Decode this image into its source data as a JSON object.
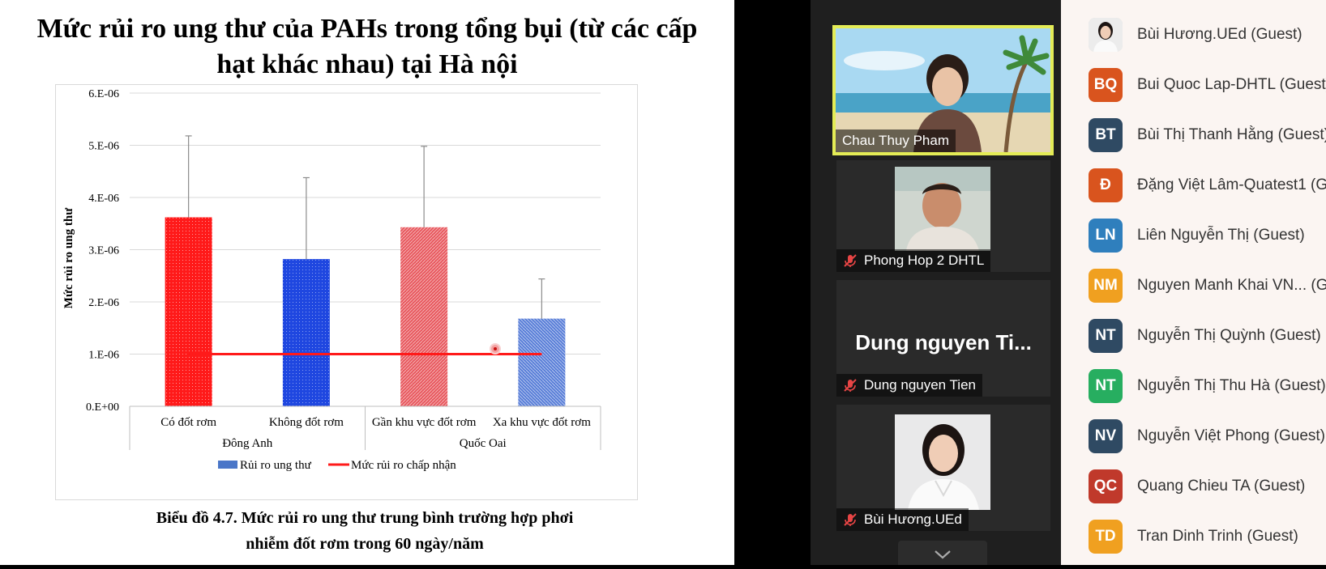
{
  "slide": {
    "title_line1": "Mức rủi ro ung thư của PAHs trong tổng bụi (từ các cấp",
    "title_line2": "hạt khác nhau) tại Hà nội",
    "caption_line1": "Biểu đồ 4.7. Mức rủi ro ung thư trung bình trường hợp phơi",
    "caption_line2": "nhiễm đốt rơm trong 60 ngày/năm"
  },
  "chart_data": {
    "type": "bar",
    "title": "",
    "ylabel": "Mức rủi ro ung thư",
    "xlabel": "",
    "ylim": [
      0,
      6e-06
    ],
    "yticks": [
      "0.E+00",
      "1.E-06",
      "2.E-06",
      "3.E-06",
      "4.E-06",
      "5.E-06",
      "6.E-06"
    ],
    "grid": true,
    "legend_position": "bottom",
    "categories": [
      "Có đốt rơm",
      "Không đốt rơm",
      "Gần khu vực đốt rơm",
      "Xa khu vực đốt rơm"
    ],
    "groups": [
      {
        "label": "Đông Anh",
        "categories": [
          "Có đốt rơm",
          "Không đốt rơm"
        ]
      },
      {
        "label": "Quốc Oai",
        "categories": [
          "Gần khu vực đốt rơm",
          "Xa khu vực đốt rơm"
        ]
      }
    ],
    "series": [
      {
        "name": "Rủi ro ung thư",
        "type": "bar",
        "values": [
          3.62e-06,
          2.82e-06,
          3.43e-06,
          1.68e-06
        ],
        "error_upper": [
          5.18e-06,
          4.38e-06,
          4.98e-06,
          2.44e-06
        ],
        "colors": [
          "#ff1a1a",
          "#1f47e0",
          "#e8595f",
          "#5a7fd8"
        ]
      },
      {
        "name": "Mức rủi ro chấp nhận",
        "type": "line",
        "values": [
          1e-06,
          1e-06,
          1e-06,
          1e-06
        ],
        "color": "#ff1a1a"
      }
    ]
  },
  "meeting": {
    "tiles": [
      {
        "name": "Chau Thuy Pham",
        "muted": false,
        "active": true
      },
      {
        "name": "Phong Hop 2 DHTL",
        "muted": true
      },
      {
        "name": "Dung nguyen Tien",
        "big_label": "Dung nguyen Ti...",
        "muted": true
      },
      {
        "name": "Bùi Hương.UEd",
        "muted": true
      }
    ],
    "scroll_icon": "chevron-down-icon"
  },
  "participants": [
    {
      "initials": "",
      "photo": true,
      "name": "Bùi Hương.UEd (Guest)",
      "color": "#d0d0d0"
    },
    {
      "initials": "BQ",
      "name": "Bui Quoc Lap-DHTL (Guest)",
      "color": "#d9541e"
    },
    {
      "initials": "BT",
      "name": "Bùi Thị Thanh Hằng (Guest)",
      "color": "#2f4a63"
    },
    {
      "initials": "Đ",
      "name": "Đặng Việt Lâm-Quatest1 (G",
      "color": "#d9541e"
    },
    {
      "initials": "LN",
      "name": "Liên Nguyễn Thị (Guest)",
      "color": "#2f7fbd"
    },
    {
      "initials": "NM",
      "name": "Nguyen Manh Khai VN...  (G",
      "color": "#f0a020"
    },
    {
      "initials": "NT",
      "name": "Nguyễn Thị Quỳnh (Guest)",
      "color": "#2f4a63"
    },
    {
      "initials": "NT",
      "name": "Nguyễn Thị Thu Hà (Guest)",
      "color": "#27ae60"
    },
    {
      "initials": "NV",
      "name": "Nguyễn Việt Phong (Guest)",
      "color": "#2f4a63"
    },
    {
      "initials": "QC",
      "name": "Quang Chieu TA (Guest)",
      "color": "#c0392b"
    },
    {
      "initials": "TD",
      "name": "Tran Dinh Trinh (Guest)",
      "color": "#f0a020"
    }
  ]
}
